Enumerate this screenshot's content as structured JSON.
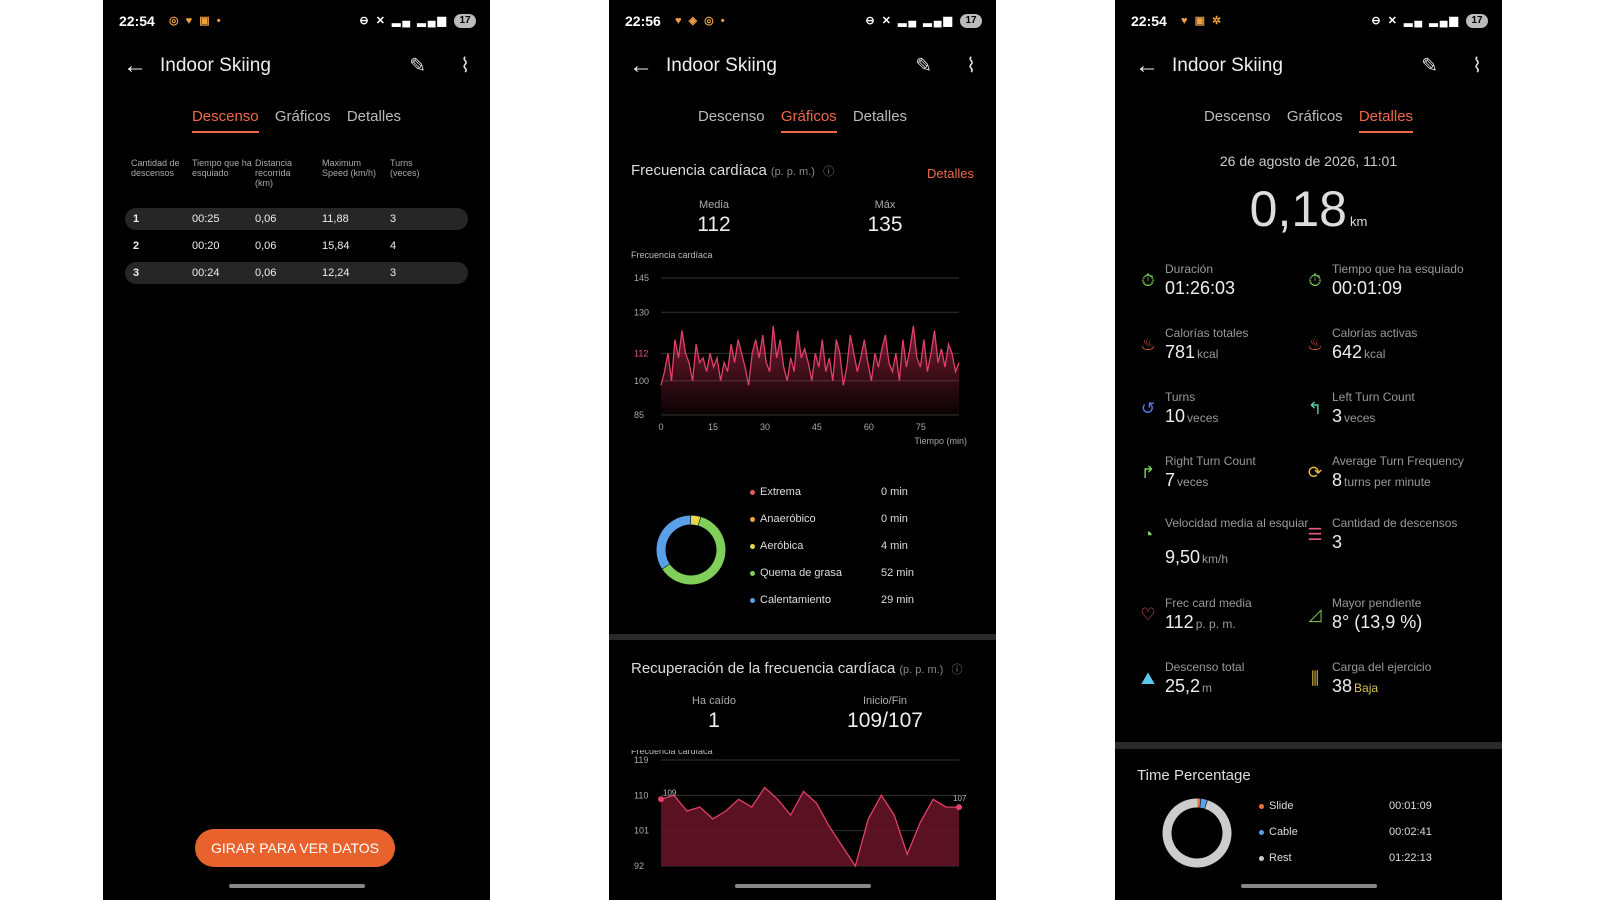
{
  "common": {
    "title": "Indoor Skiing",
    "tabs": [
      "Descenso",
      "Gráficos",
      "Detalles"
    ],
    "battery": "17"
  },
  "phone1": {
    "time": "22:54",
    "table": {
      "headers": [
        "Cantidad de descensos",
        "Tiempo que ha esquiado",
        "Distancia recorrida (km)",
        "Maximum Speed (km/h)",
        "Turns (veces)"
      ],
      "rows": [
        [
          "1",
          "00:25",
          "0,06",
          "11,88",
          "3"
        ],
        [
          "2",
          "00:20",
          "0,06",
          "15,84",
          "4"
        ],
        [
          "3",
          "00:24",
          "0,06",
          "12,24",
          "3"
        ]
      ]
    },
    "rotate_button": "GIRAR PARA VER DATOS"
  },
  "phone2": {
    "time": "22:56",
    "hr": {
      "title": "Frecuencia cardíaca",
      "unit": "(p. p. m.)",
      "details_link": "Detalles",
      "avg_label": "Media",
      "avg": "112",
      "max_label": "Máx",
      "max": "135"
    },
    "zones": [
      {
        "name": "Extrema",
        "minutes": "0 min",
        "color": "#e85a5a"
      },
      {
        "name": "Anaeróbico",
        "minutes": "0 min",
        "color": "#f0a040"
      },
      {
        "name": "Aeróbica",
        "minutes": "4 min",
        "color": "#e8d64a"
      },
      {
        "name": "Quema de grasa",
        "minutes": "52 min",
        "color": "#7fcf5a"
      },
      {
        "name": "Calentamiento",
        "minutes": "29 min",
        "color": "#5aa0e8"
      }
    ],
    "recovery": {
      "title": "Recuperación de la frecuencia cardíaca",
      "unit": "(p. p. m.)",
      "drop_label": "Ha caído",
      "drop": "1",
      "startend_label": "Inicio/Fin",
      "startend": "109/107"
    }
  },
  "phone3": {
    "time": "22:54",
    "datetime": "26 de agosto de 2026, 11:01",
    "distance": "0,18",
    "distance_unit": "km",
    "metrics": [
      {
        "label": "Duración",
        "value": "01:26:03",
        "unit": "",
        "icon": "stopwatch-icon",
        "color": "#7fcf5a"
      },
      {
        "label": "Tiempo que ha esquiado",
        "value": "00:01:09",
        "unit": "",
        "icon": "stopwatch-icon",
        "color": "#7fcf5a"
      },
      {
        "label": "Calorías totales",
        "value": "781",
        "unit": "kcal",
        "icon": "flame-icon",
        "color": "#e85a3a"
      },
      {
        "label": "Calorías activas",
        "value": "642",
        "unit": "kcal",
        "icon": "flame-icon",
        "color": "#e85a3a"
      },
      {
        "label": "Turns",
        "value": "10",
        "unit": "veces",
        "icon": "turn-icon",
        "color": "#5a7ae8"
      },
      {
        "label": "Left Turn Count",
        "value": "3",
        "unit": "veces",
        "icon": "turn-left-icon",
        "color": "#5ac8a8"
      },
      {
        "label": "Right Turn Count",
        "value": "7",
        "unit": "veces",
        "icon": "turn-right-icon",
        "color": "#7fcf5a"
      },
      {
        "label": "Average Turn Frequency",
        "value": "8",
        "unit": "turns per minute",
        "icon": "frequency-icon",
        "color": "#e8c04a"
      },
      {
        "label": "Velocidad media al esquiar",
        "value": "9,50",
        "unit": "km/h",
        "icon": "speedometer-icon",
        "color": "#7fcf5a"
      },
      {
        "label": "Cantidad de descensos",
        "value": "3",
        "unit": "",
        "icon": "runs-icon",
        "color": "#e85a7a"
      },
      {
        "label": "Frec card media",
        "value": "112",
        "unit": "p. p. m.",
        "icon": "heart-icon",
        "color": "#e85a5a"
      },
      {
        "label": "Mayor pendiente",
        "value": "8° (13,9 %)",
        "unit": "",
        "icon": "slope-icon",
        "color": "#7fcf5a"
      },
      {
        "label": "Descenso total",
        "value": "25,2",
        "unit": "m",
        "icon": "descent-icon",
        "color": "#5ac8e8"
      },
      {
        "label": "Carga del ejercicio",
        "value": "38",
        "unit": "Baja",
        "icon": "dumbbell-icon",
        "color": "#e8c04a"
      }
    ],
    "time_percentage": {
      "title": "Time Percentage",
      "items": [
        {
          "name": "Slide",
          "time": "00:01:09",
          "color": "#f07040"
        },
        {
          "name": "Cable",
          "time": "00:02:41",
          "color": "#5aa0e8"
        },
        {
          "name": "Rest",
          "time": "01:22:13",
          "color": "#cccccc"
        }
      ]
    }
  },
  "chart_data": [
    {
      "type": "line",
      "title": "Frecuencia cardíaca",
      "ylabel": "Frecuencia cardíaca",
      "xlabel": "Tiempo (min)",
      "x_ticks": [
        0,
        15,
        30,
        45,
        60,
        75
      ],
      "y_ticks": [
        85,
        100,
        112,
        130,
        145
      ],
      "ylim": [
        85,
        145
      ],
      "xlim": [
        0,
        86
      ],
      "series": [
        {
          "values": [
            98,
            104,
            112,
            100,
            118,
            110,
            122,
            112,
            108,
            100,
            116,
            108,
            110,
            104,
            112,
            106,
            110,
            100,
            108,
            104,
            116,
            108,
            118,
            112,
            106,
            98,
            112,
            118,
            110,
            120,
            108,
            104,
            124,
            110,
            118,
            106,
            100,
            110,
            104,
            122,
            110,
            114,
            108,
            100,
            112,
            106,
            118,
            104,
            110,
            100,
            118,
            112,
            98,
            106,
            120,
            112,
            104,
            110,
            118,
            108,
            100,
            112,
            106,
            114,
            120,
            108,
            104,
            112,
            100,
            118,
            106,
            114,
            124,
            110,
            106,
            118,
            104,
            112,
            122,
            108,
            114,
            106,
            116,
            112,
            104,
            108
          ]
        }
      ]
    },
    {
      "type": "area",
      "title": "Recuperación de la frecuencia cardíaca",
      "ylabel": "Frecuencia cardíaca",
      "y_ticks": [
        92,
        101,
        110,
        119
      ],
      "ylim": [
        92,
        119
      ],
      "annotations": [
        "109",
        "107"
      ],
      "series": [
        {
          "values": [
            109,
            110,
            106,
            107,
            104,
            106,
            109,
            107,
            112,
            109,
            105,
            111,
            108,
            102,
            97,
            92,
            104,
            110,
            105,
            95,
            103,
            109,
            107,
            107
          ]
        }
      ]
    },
    {
      "type": "pie",
      "title": "",
      "labels": [
        "Extrema",
        "Anaeróbico",
        "Aeróbica",
        "Quema de grasa",
        "Calentamiento"
      ],
      "values": [
        0,
        0,
        4,
        52,
        29
      ]
    },
    {
      "type": "pie",
      "title": "Time Percentage",
      "labels": [
        "Slide",
        "Cable",
        "Rest"
      ],
      "values": [
        69,
        161,
        4933
      ]
    }
  ]
}
